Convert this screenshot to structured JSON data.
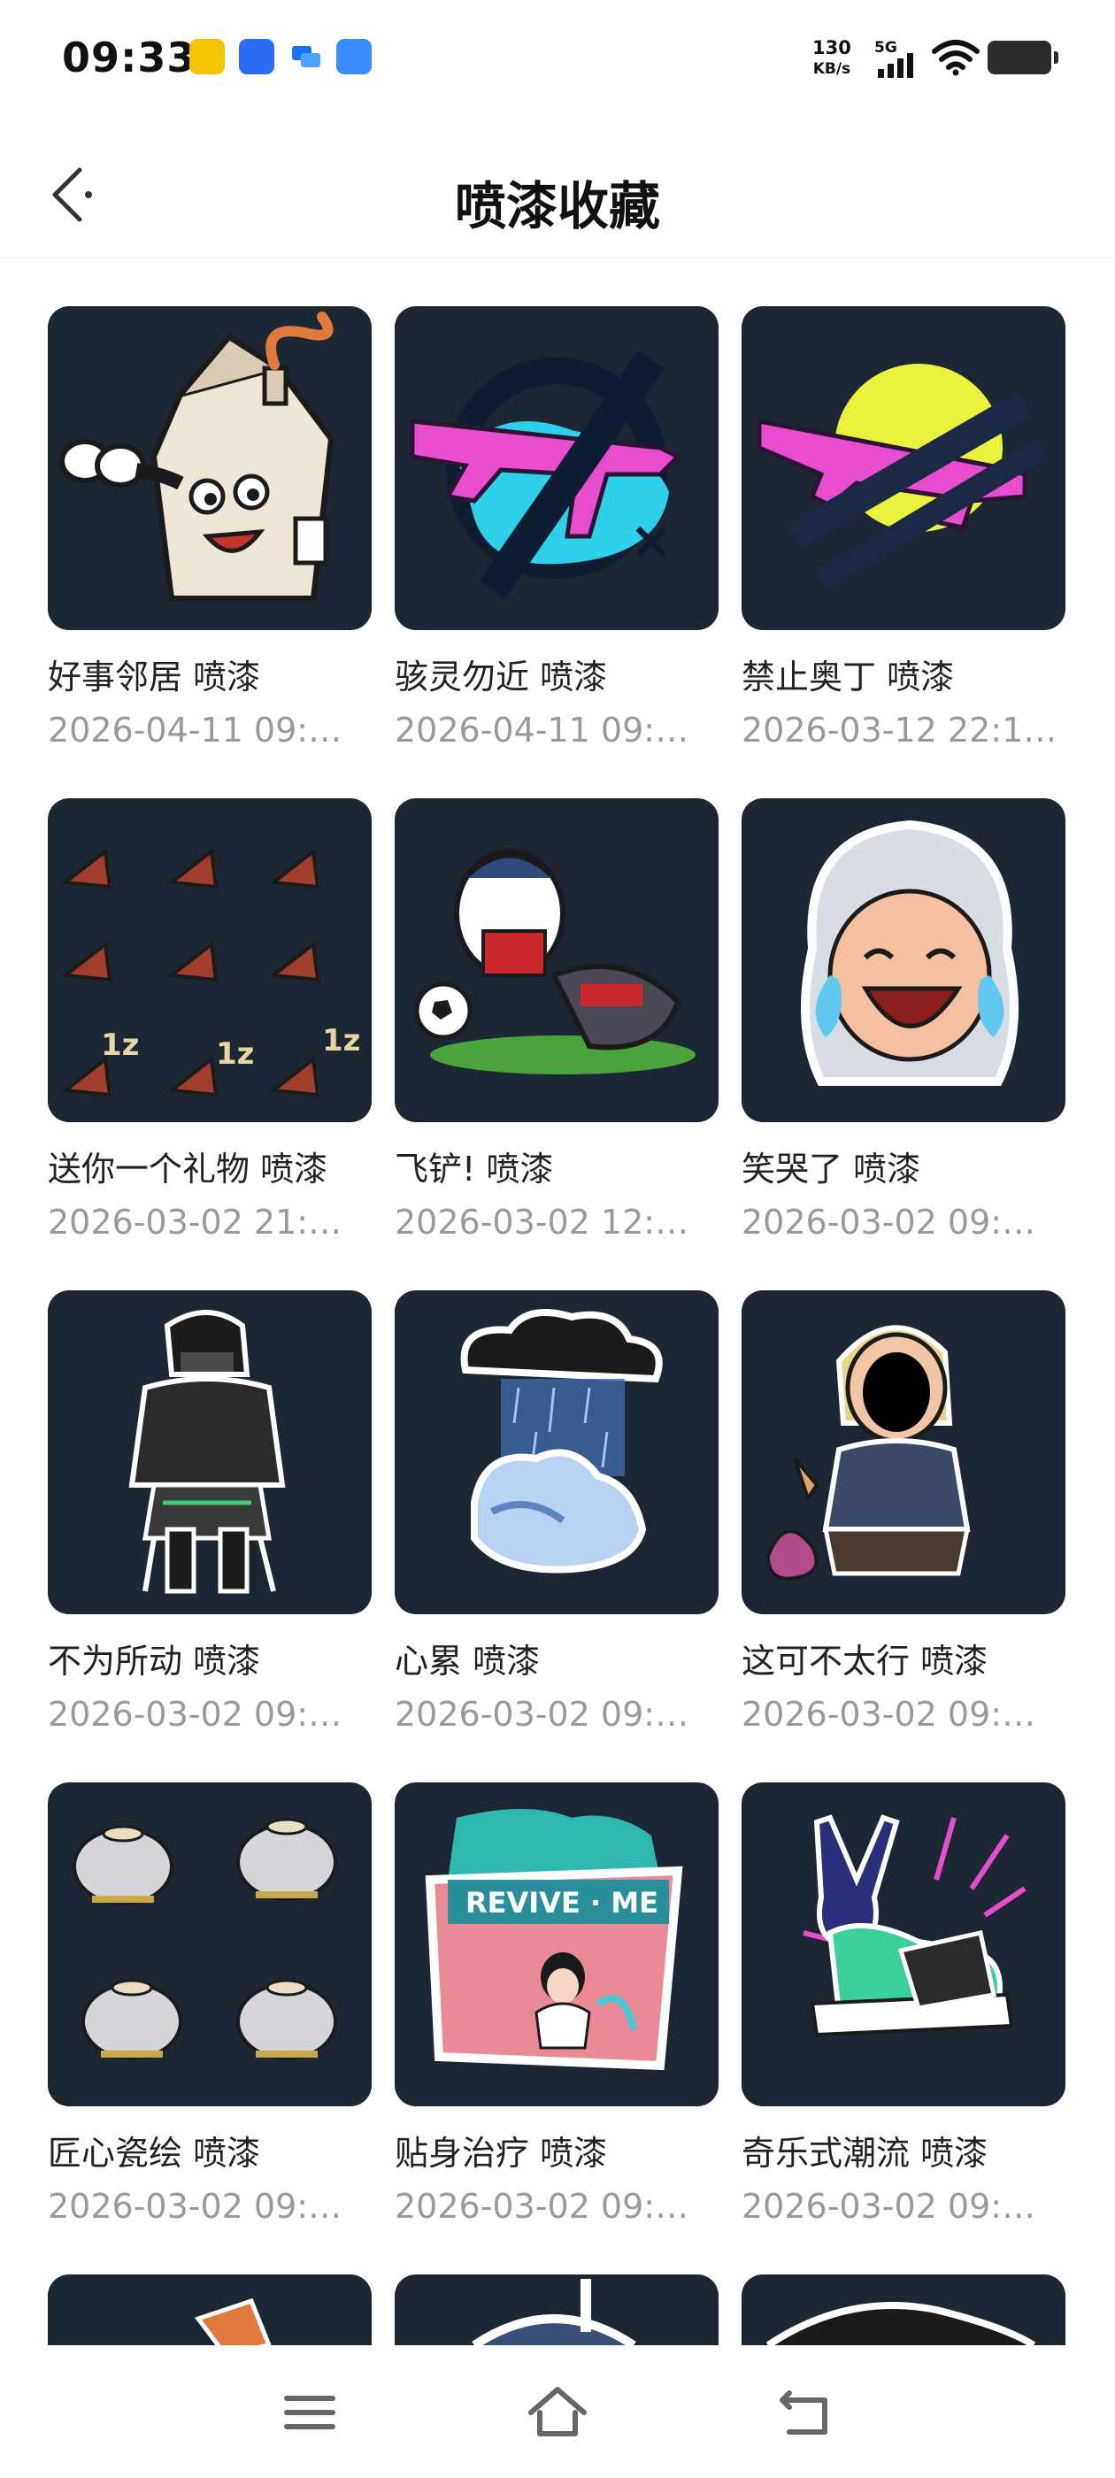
{
  "status_bar": {
    "time": "09:33",
    "net_speed_value": "130",
    "net_speed_unit": "KB/s",
    "network": "5G",
    "notification_icons": [
      "app-notification-icon",
      "baidu-icon",
      "chat-icon",
      "files-icon"
    ]
  },
  "header": {
    "title": "喷漆收藏",
    "back_icon": "chevron-left-icon"
  },
  "sprays": [
    {
      "name": "好事邻居 喷漆",
      "date": "2026-04-11 09:…",
      "icon": "house-binoculars-spray"
    },
    {
      "name": "骇灵勿近 喷漆",
      "date": "2026-04-11 09:…",
      "icon": "crossed-rifle-spray"
    },
    {
      "name": "禁止奥丁 喷漆",
      "date": "2026-03-12 22:1…",
      "icon": "crossed-machine-gun-spray"
    },
    {
      "name": "送你一个礼物 喷漆",
      "date": "2026-03-02 21:…",
      "icon": "gift-cones-spray"
    },
    {
      "name": "飞铲! 喷漆",
      "date": "2026-03-02 12:…",
      "icon": "penguin-tackle-spray"
    },
    {
      "name": "笑哭了 喷漆",
      "date": "2026-03-02 09:…",
      "icon": "laughing-crying-spray"
    },
    {
      "name": "不为所动 喷漆",
      "date": "2026-03-02 09:…",
      "icon": "seated-agent-spray"
    },
    {
      "name": "心累 喷漆",
      "date": "2026-03-02 09:…",
      "icon": "rain-cloud-spray"
    },
    {
      "name": "这可不太行 喷漆",
      "date": "2026-03-02 09:…",
      "icon": "screaming-agent-spray"
    },
    {
      "name": "匠心瓷绘 喷漆",
      "date": "2026-03-02 09:…",
      "icon": "teapots-spray"
    },
    {
      "name": "贴身治疗 喷漆",
      "date": "2026-03-02 09:…",
      "icon": "revive-me-spray"
    },
    {
      "name": "奇乐式潮流 喷漆",
      "date": "2026-03-02 09:…",
      "icon": "peace-sneakers-spray"
    },
    {
      "name": "",
      "date": "",
      "icon": "partial-spray-1"
    },
    {
      "name": "",
      "date": "",
      "icon": "partial-spray-2"
    },
    {
      "name": "",
      "date": "",
      "icon": "partial-spray-3"
    }
  ],
  "revive_text": "REVIVE · ME",
  "gift_labels": [
    "1z",
    "1z",
    "1z"
  ],
  "nav": {
    "icons": [
      "menu-icon",
      "home-icon",
      "back-icon"
    ]
  }
}
